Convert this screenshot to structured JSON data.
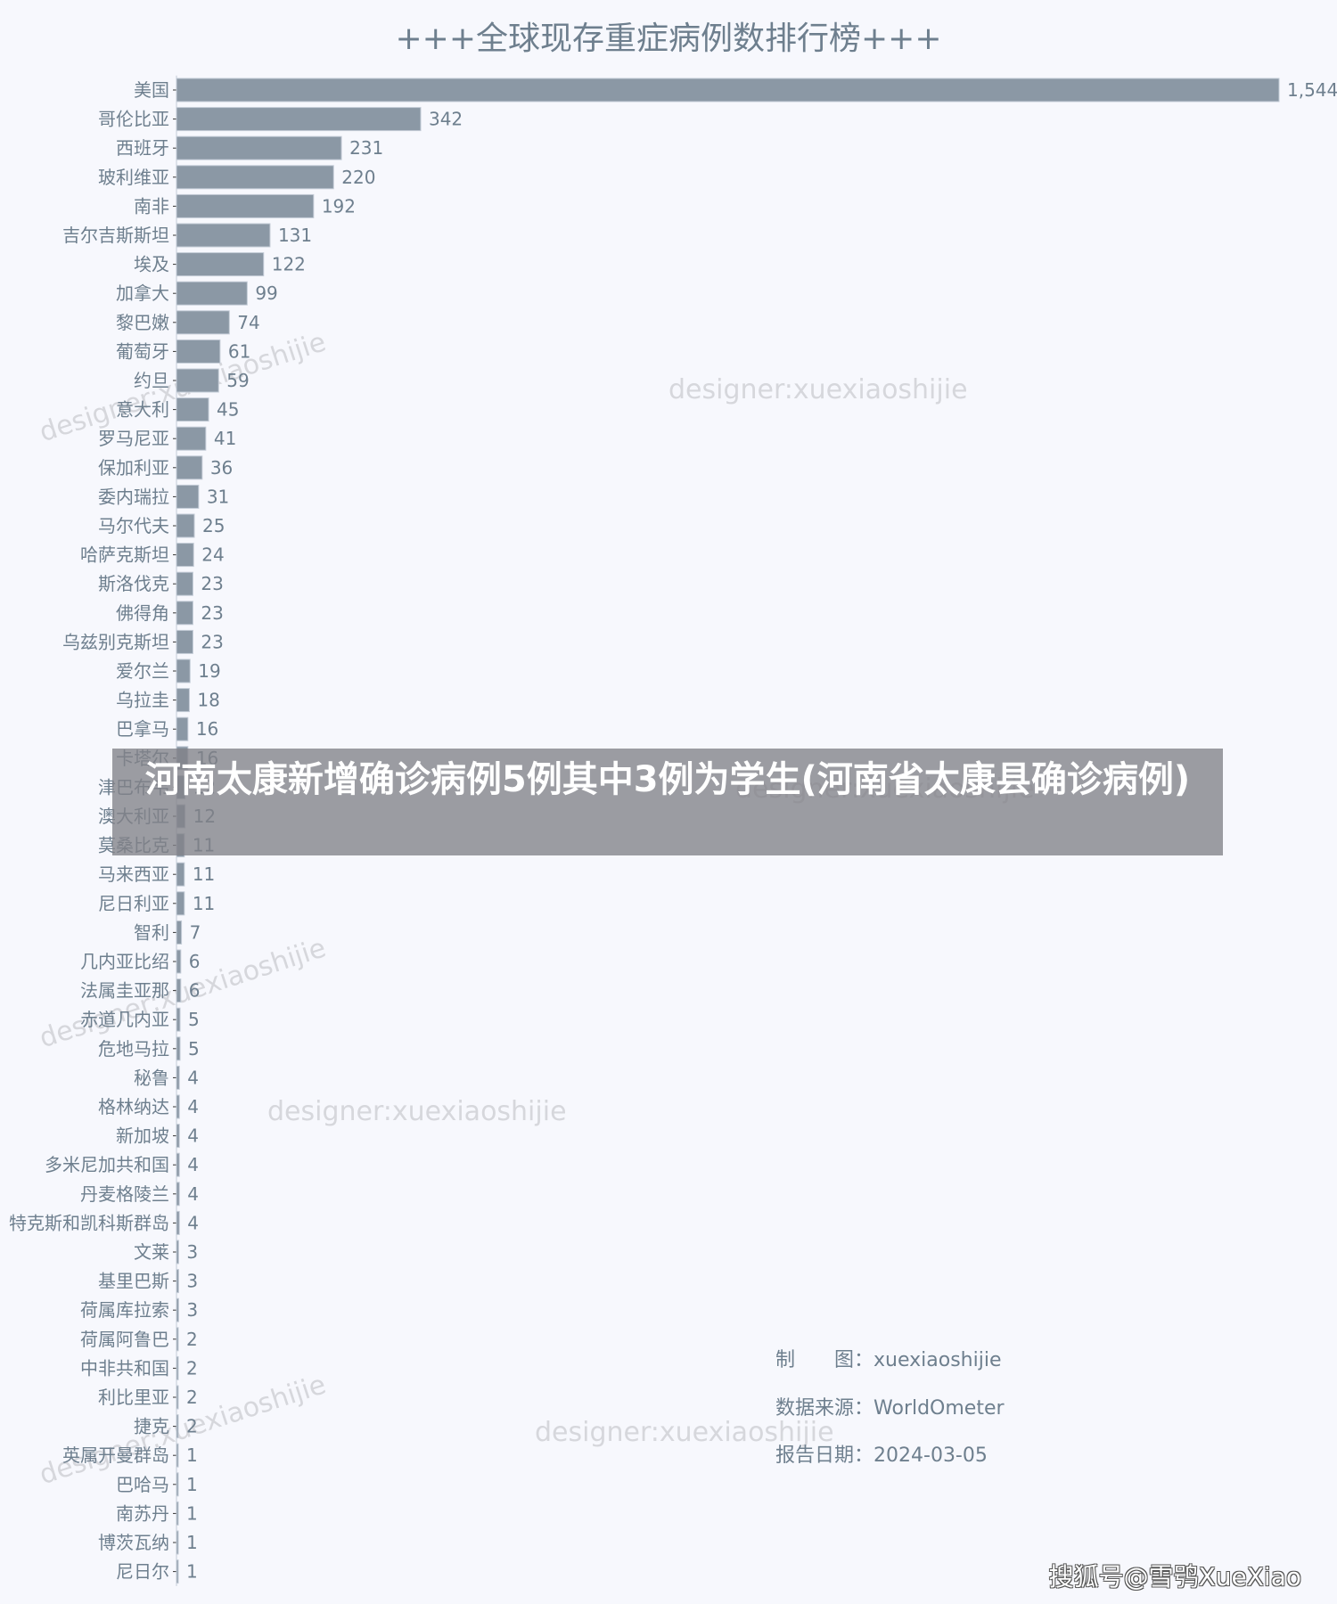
{
  "chart_data": {
    "type": "bar",
    "orientation": "horizontal",
    "title": "+++全球现存重症病例数排行榜+++",
    "xlabel": "",
    "ylabel": "",
    "xlim": [
      0,
      1544
    ],
    "grid": false,
    "legend": "none",
    "bar_color": "#8b98a5",
    "categories": [
      "美国",
      "哥伦比亚",
      "西班牙",
      "玻利维亚",
      "南非",
      "吉尔吉斯斯坦",
      "埃及",
      "加拿大",
      "黎巴嫩",
      "葡萄牙",
      "约旦",
      "意大利",
      "罗马尼亚",
      "保加利亚",
      "委内瑞拉",
      "马尔代夫",
      "哈萨克斯坦",
      "斯洛伐克",
      "佛得角",
      "乌兹别克斯坦",
      "爱尔兰",
      "乌拉圭",
      "巴拿马",
      "卡塔尔",
      "津巴布韦",
      "澳大利亚",
      "莫桑比克",
      "马来西亚",
      "尼日利亚",
      "智利",
      "几内亚比绍",
      "法属圭亚那",
      "赤道几内亚",
      "危地马拉",
      "秘鲁",
      "格林纳达",
      "新加坡",
      "多米尼加共和国",
      "丹麦格陵兰",
      "特克斯和凯科斯群岛",
      "文莱",
      "基里巴斯",
      "荷属库拉索",
      "荷属阿鲁巴",
      "中非共和国",
      "利比里亚",
      "捷克",
      "英属开曼群岛",
      "巴哈马",
      "南苏丹",
      "博茨瓦纳",
      "尼日尔"
    ],
    "values": [
      1544,
      342,
      231,
      220,
      192,
      131,
      122,
      99,
      74,
      61,
      59,
      45,
      41,
      36,
      31,
      25,
      24,
      23,
      23,
      23,
      19,
      18,
      16,
      16,
      12,
      12,
      11,
      11,
      11,
      7,
      6,
      6,
      5,
      5,
      4,
      4,
      4,
      4,
      4,
      4,
      3,
      3,
      3,
      2,
      2,
      2,
      2,
      1,
      1,
      1,
      1,
      1
    ],
    "value_labels": [
      "1,544",
      "342",
      "231",
      "220",
      "192",
      "131",
      "122",
      "99",
      "74",
      "61",
      "59",
      "45",
      "41",
      "36",
      "31",
      "25",
      "24",
      "23",
      "23",
      "23",
      "19",
      "18",
      "16",
      "16",
      "12",
      "12",
      "11",
      "11",
      "11",
      "7",
      "6",
      "6",
      "5",
      "5",
      "4",
      "4",
      "4",
      "4",
      "4",
      "4",
      "3",
      "3",
      "3",
      "2",
      "2",
      "2",
      "2",
      "1",
      "1",
      "1",
      "1",
      "1"
    ]
  },
  "watermark": "designer:xuexiaoshijie",
  "banner": {
    "text": "河南太康新增确诊病例5例其中3例为学生(河南省太康县确诊病例)"
  },
  "info": {
    "maker_label": "制　　图：",
    "maker_value": "xuexiaoshijie",
    "source_label": "数据来源：",
    "source_value": "WorldOmeter",
    "date_label": "报告日期：",
    "date_value": "2024-03-05"
  },
  "footer": "搜狐号@雪鸮XueXiao"
}
